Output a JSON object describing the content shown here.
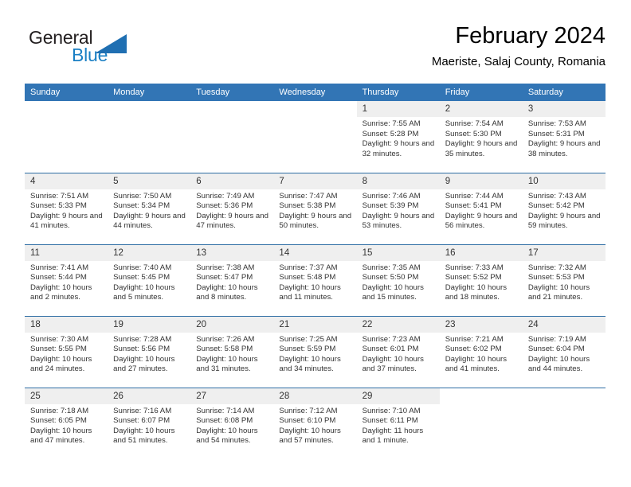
{
  "brand": {
    "name_part1": "General",
    "name_part2": "Blue",
    "triangle_color": "#1f6fb2"
  },
  "header": {
    "title": "February 2024",
    "subtitle": "Maeriste, Salaj County, Romania"
  },
  "theme": {
    "header_blue": "#3275b5",
    "row_rule_blue": "#2e6da4",
    "daynum_band": "#efefef",
    "text": "#333333"
  },
  "weekdays": [
    "Sunday",
    "Monday",
    "Tuesday",
    "Wednesday",
    "Thursday",
    "Friday",
    "Saturday"
  ],
  "weeks": [
    [
      {
        "day": "",
        "blank": true
      },
      {
        "day": "",
        "blank": true
      },
      {
        "day": "",
        "blank": true
      },
      {
        "day": "",
        "blank": true
      },
      {
        "day": "1",
        "sunrise": "Sunrise: 7:55 AM",
        "sunset": "Sunset: 5:28 PM",
        "daylight": "Daylight: 9 hours and 32 minutes."
      },
      {
        "day": "2",
        "sunrise": "Sunrise: 7:54 AM",
        "sunset": "Sunset: 5:30 PM",
        "daylight": "Daylight: 9 hours and 35 minutes."
      },
      {
        "day": "3",
        "sunrise": "Sunrise: 7:53 AM",
        "sunset": "Sunset: 5:31 PM",
        "daylight": "Daylight: 9 hours and 38 minutes."
      }
    ],
    [
      {
        "day": "4",
        "sunrise": "Sunrise: 7:51 AM",
        "sunset": "Sunset: 5:33 PM",
        "daylight": "Daylight: 9 hours and 41 minutes."
      },
      {
        "day": "5",
        "sunrise": "Sunrise: 7:50 AM",
        "sunset": "Sunset: 5:34 PM",
        "daylight": "Daylight: 9 hours and 44 minutes."
      },
      {
        "day": "6",
        "sunrise": "Sunrise: 7:49 AM",
        "sunset": "Sunset: 5:36 PM",
        "daylight": "Daylight: 9 hours and 47 minutes."
      },
      {
        "day": "7",
        "sunrise": "Sunrise: 7:47 AM",
        "sunset": "Sunset: 5:38 PM",
        "daylight": "Daylight: 9 hours and 50 minutes."
      },
      {
        "day": "8",
        "sunrise": "Sunrise: 7:46 AM",
        "sunset": "Sunset: 5:39 PM",
        "daylight": "Daylight: 9 hours and 53 minutes."
      },
      {
        "day": "9",
        "sunrise": "Sunrise: 7:44 AM",
        "sunset": "Sunset: 5:41 PM",
        "daylight": "Daylight: 9 hours and 56 minutes."
      },
      {
        "day": "10",
        "sunrise": "Sunrise: 7:43 AM",
        "sunset": "Sunset: 5:42 PM",
        "daylight": "Daylight: 9 hours and 59 minutes."
      }
    ],
    [
      {
        "day": "11",
        "sunrise": "Sunrise: 7:41 AM",
        "sunset": "Sunset: 5:44 PM",
        "daylight": "Daylight: 10 hours and 2 minutes."
      },
      {
        "day": "12",
        "sunrise": "Sunrise: 7:40 AM",
        "sunset": "Sunset: 5:45 PM",
        "daylight": "Daylight: 10 hours and 5 minutes."
      },
      {
        "day": "13",
        "sunrise": "Sunrise: 7:38 AM",
        "sunset": "Sunset: 5:47 PM",
        "daylight": "Daylight: 10 hours and 8 minutes."
      },
      {
        "day": "14",
        "sunrise": "Sunrise: 7:37 AM",
        "sunset": "Sunset: 5:48 PM",
        "daylight": "Daylight: 10 hours and 11 minutes."
      },
      {
        "day": "15",
        "sunrise": "Sunrise: 7:35 AM",
        "sunset": "Sunset: 5:50 PM",
        "daylight": "Daylight: 10 hours and 15 minutes."
      },
      {
        "day": "16",
        "sunrise": "Sunrise: 7:33 AM",
        "sunset": "Sunset: 5:52 PM",
        "daylight": "Daylight: 10 hours and 18 minutes."
      },
      {
        "day": "17",
        "sunrise": "Sunrise: 7:32 AM",
        "sunset": "Sunset: 5:53 PM",
        "daylight": "Daylight: 10 hours and 21 minutes."
      }
    ],
    [
      {
        "day": "18",
        "sunrise": "Sunrise: 7:30 AM",
        "sunset": "Sunset: 5:55 PM",
        "daylight": "Daylight: 10 hours and 24 minutes."
      },
      {
        "day": "19",
        "sunrise": "Sunrise: 7:28 AM",
        "sunset": "Sunset: 5:56 PM",
        "daylight": "Daylight: 10 hours and 27 minutes."
      },
      {
        "day": "20",
        "sunrise": "Sunrise: 7:26 AM",
        "sunset": "Sunset: 5:58 PM",
        "daylight": "Daylight: 10 hours and 31 minutes."
      },
      {
        "day": "21",
        "sunrise": "Sunrise: 7:25 AM",
        "sunset": "Sunset: 5:59 PM",
        "daylight": "Daylight: 10 hours and 34 minutes."
      },
      {
        "day": "22",
        "sunrise": "Sunrise: 7:23 AM",
        "sunset": "Sunset: 6:01 PM",
        "daylight": "Daylight: 10 hours and 37 minutes."
      },
      {
        "day": "23",
        "sunrise": "Sunrise: 7:21 AM",
        "sunset": "Sunset: 6:02 PM",
        "daylight": "Daylight: 10 hours and 41 minutes."
      },
      {
        "day": "24",
        "sunrise": "Sunrise: 7:19 AM",
        "sunset": "Sunset: 6:04 PM",
        "daylight": "Daylight: 10 hours and 44 minutes."
      }
    ],
    [
      {
        "day": "25",
        "sunrise": "Sunrise: 7:18 AM",
        "sunset": "Sunset: 6:05 PM",
        "daylight": "Daylight: 10 hours and 47 minutes."
      },
      {
        "day": "26",
        "sunrise": "Sunrise: 7:16 AM",
        "sunset": "Sunset: 6:07 PM",
        "daylight": "Daylight: 10 hours and 51 minutes."
      },
      {
        "day": "27",
        "sunrise": "Sunrise: 7:14 AM",
        "sunset": "Sunset: 6:08 PM",
        "daylight": "Daylight: 10 hours and 54 minutes."
      },
      {
        "day": "28",
        "sunrise": "Sunrise: 7:12 AM",
        "sunset": "Sunset: 6:10 PM",
        "daylight": "Daylight: 10 hours and 57 minutes."
      },
      {
        "day": "29",
        "sunrise": "Sunrise: 7:10 AM",
        "sunset": "Sunset: 6:11 PM",
        "daylight": "Daylight: 11 hours and 1 minute."
      },
      {
        "day": "",
        "blank": true
      },
      {
        "day": "",
        "blank": true
      }
    ]
  ]
}
